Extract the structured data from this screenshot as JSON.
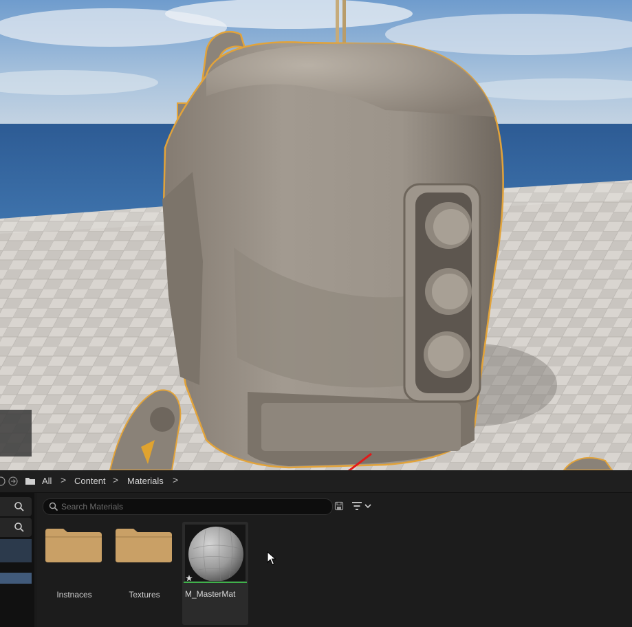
{
  "path_bar": {
    "crumbs": [
      "All",
      "Content",
      "Materials"
    ],
    "separators": [
      ">",
      ">",
      ">"
    ]
  },
  "search": {
    "placeholder": "Search Materials",
    "value": ""
  },
  "assets": [
    {
      "name": "Instnaces",
      "type": "folder"
    },
    {
      "name": "Textures",
      "type": "folder"
    },
    {
      "name": "M_MasterMat",
      "type": "material"
    }
  ],
  "icons": {
    "back": "back-arrow-icon",
    "forward": "forward-arrow-icon",
    "folder": "folder-icon",
    "search": "search-icon",
    "save": "save-icon",
    "filter": "filter-icon",
    "chevron": "chevron-down-icon"
  },
  "colors": {
    "selection_outline": "#e2a33a",
    "folder": "#c9a066",
    "annotation_arrow": "#e01b1b",
    "material_underline": "#3fb24a"
  }
}
